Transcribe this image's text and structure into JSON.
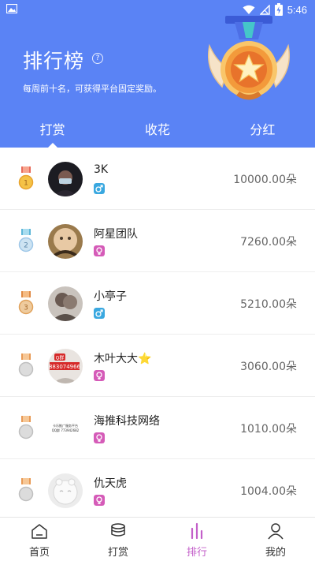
{
  "status_bar": {
    "time": "5:46"
  },
  "header": {
    "title": "排行榜",
    "help_icon": "question-circle-icon",
    "subtitle": "每周前十名，可获得平台固定奖励。"
  },
  "tabs": [
    {
      "label": "打赏",
      "active": true
    },
    {
      "label": "收花",
      "active": false
    },
    {
      "label": "分红",
      "active": false
    }
  ],
  "ranking": [
    {
      "rank": "1",
      "name": "3K",
      "gender": "male",
      "amount": "10000.00朵"
    },
    {
      "rank": "2",
      "name": "阿星团队",
      "gender": "female",
      "amount": "7260.00朵"
    },
    {
      "rank": "3",
      "name": "小亭子",
      "gender": "male",
      "amount": "5210.00朵"
    },
    {
      "rank": "",
      "name": "木叶大大⭐",
      "gender": "female",
      "amount": "3060.00朵"
    },
    {
      "rank": "",
      "name": "海推科技网络",
      "gender": "female",
      "amount": "1010.00朵"
    },
    {
      "rank": "",
      "name": "仇天虎",
      "gender": "female",
      "amount": "1004.00朵"
    }
  ],
  "avatar_texts": {
    "row4_badge": "Q群",
    "row4_number": "883074966",
    "row5_line1": "卡乐推广服务平台",
    "row5_line2": "QQ群 773942682"
  },
  "bottom_nav": [
    {
      "label": "首页",
      "icon": "home-icon",
      "active": false
    },
    {
      "label": "打赏",
      "icon": "coins-icon",
      "active": false
    },
    {
      "label": "排行",
      "icon": "bar-chart-icon",
      "active": true
    },
    {
      "label": "我的",
      "icon": "user-icon",
      "active": false
    }
  ],
  "colors": {
    "header_bg": "#5a83f5",
    "male": "#3aa8e0",
    "female": "#d55bb8",
    "active_nav": "#c35fc9",
    "gold": "#f0a640",
    "silver": "#9ec7e8",
    "bronze": "#e0a15a"
  }
}
